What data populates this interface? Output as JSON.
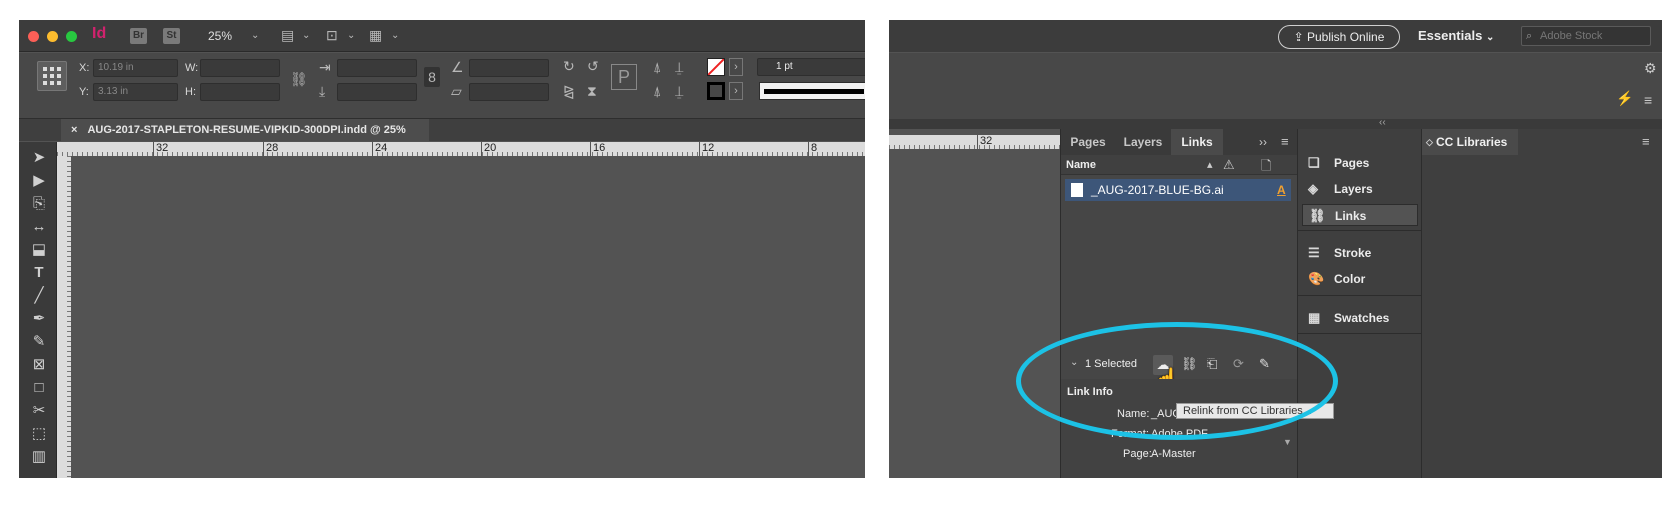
{
  "left": {
    "app_badges": [
      "Br",
      "St"
    ],
    "zoom": "25%",
    "controls": {
      "x_label": "X:",
      "y_label": "Y:",
      "w_label": "W:",
      "h_label": "H:",
      "x_value": "10.19 in",
      "y_value": "3.13 in",
      "stroke_weight": "1 pt"
    },
    "doc_tab": {
      "close": "×",
      "title": "AUG-2017-STAPLETON-RESUME-VIPKID-300DPI.indd @ 25%"
    },
    "ruler_labels": [
      "32",
      "28",
      "24",
      "20",
      "16",
      "12",
      "8"
    ]
  },
  "right": {
    "publish_label": "Publish Online",
    "workspace": "Essentials",
    "stock_placeholder": "Adobe Stock",
    "ruler_label": "32",
    "tabs": [
      {
        "label": "Pages"
      },
      {
        "label": "Layers"
      },
      {
        "label": "Links"
      }
    ],
    "name_header": "Name",
    "link_row": {
      "name": "_AUG-2017-BLUE-BG.ai",
      "flag": "A"
    },
    "selected": "1 Selected",
    "tooltip": "Relink from CC Libraries...",
    "link_info": {
      "heading": "Link Info",
      "name_label": "Name:",
      "name_value": "_AUG-2017-BLUE-BG.ai",
      "format_label": "Format:",
      "format_value": "Adobe PDF",
      "page_label": "Page:",
      "page_value": "A-Master"
    },
    "dock": [
      {
        "label": "Pages",
        "icon": "pages-icon"
      },
      {
        "label": "Layers",
        "icon": "layers-icon"
      },
      {
        "label": "Links",
        "icon": "links-icon"
      },
      {
        "label": "Stroke",
        "icon": "stroke-icon"
      },
      {
        "label": "Color",
        "icon": "color-icon"
      },
      {
        "label": "Swatches",
        "icon": "swatches-icon"
      }
    ],
    "cc_libraries": "CC Libraries"
  },
  "colors": {
    "highlight_ellipse": "#1cc2e6",
    "selection_row": "#3d5679",
    "indesign_brand": "#d1226e"
  }
}
